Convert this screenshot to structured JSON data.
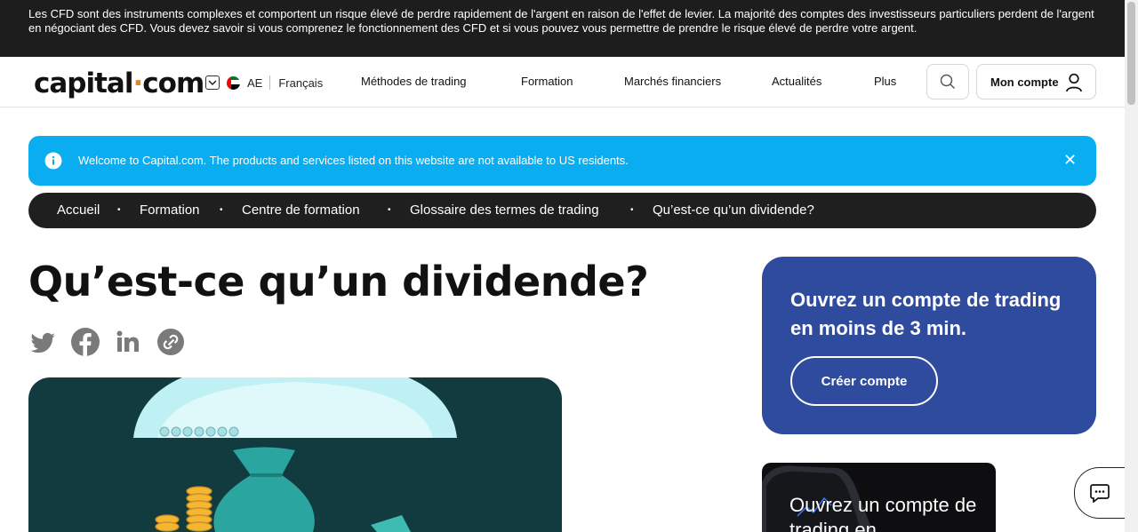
{
  "risk_warning": "Les CFD sont des instruments complexes et comportent un risque élevé de perdre rapidement de l'argent en raison de l'effet de levier. La majorité des comptes des investisseurs particuliers perdent de l'argent en négociant des CFD. Vous devez savoir si vous comprenez le fonctionnement des CFD et si vous pouvez vous permettre de prendre le risque élevé de perdre votre argent.",
  "header": {
    "logo_left": "capital",
    "logo_dot": "·",
    "logo_right": "com",
    "region_code": "AE",
    "language": "Français",
    "nav": [
      "Méthodes de trading",
      "Formation",
      "Marchés financiers",
      "Actualités",
      "Plus"
    ],
    "account_label": "Mon compte"
  },
  "banner": {
    "message": "Welcome to Capital.com. The products and services listed on this website are not available to US residents.",
    "close": "✕"
  },
  "breadcrumb": [
    "Accueil",
    "Formation",
    "Centre de formation",
    "Glossaire des termes de trading",
    "Qu’est-ce qu’un dividende?"
  ],
  "breadcrumb_sep": "•",
  "page_title": "Qu’est-ce qu’un dividende?",
  "cta": {
    "heading": "Ouvrez un compte de trading en moins de 3 min.",
    "button": "Créer compte"
  },
  "promo": {
    "text": "Ouvrez un compte de trading en"
  },
  "colors": {
    "risk_bar": "#1d1d1d",
    "banner": "#0aaef0",
    "breadcrumb_bg": "#1f1f1f",
    "cta_bg": "#2f4b9e",
    "hero_bg": "#123b40",
    "logo_dot": "#e4872b"
  },
  "icons": [
    "twitter-icon",
    "facebook-icon",
    "linkedin-icon",
    "copy-link-icon",
    "search-icon",
    "user-icon",
    "info-icon",
    "chat-icon",
    "chevron-down-icon"
  ]
}
